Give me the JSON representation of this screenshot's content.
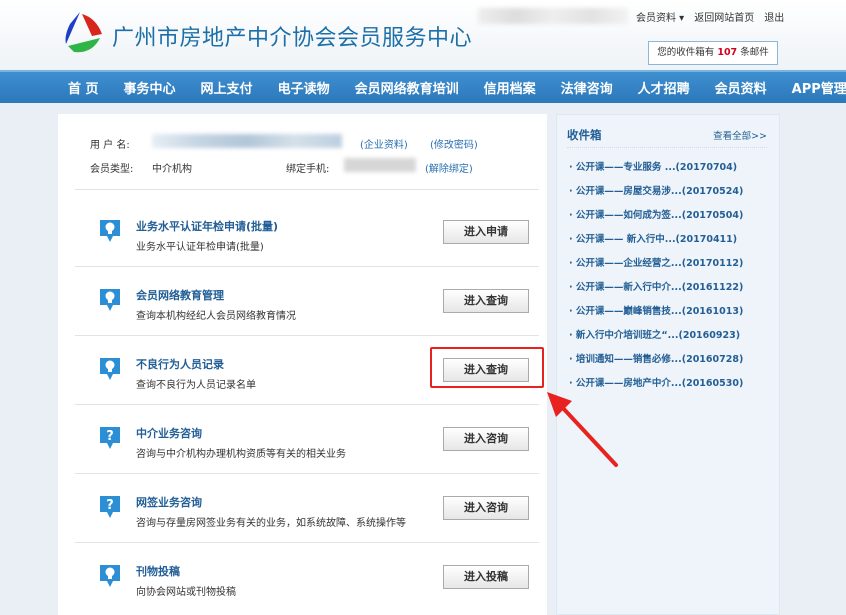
{
  "header": {
    "title": "广州市房地产中介协会会员服务中心",
    "links": [
      "会员资料 ▾",
      "返回网站首页",
      "退出"
    ],
    "mail_prefix": "您的收件箱有",
    "mail_count": "107",
    "mail_suffix": "条邮件"
  },
  "nav": [
    "首 页",
    "事务中心",
    "网上支付",
    "电子读物",
    "会员网络教育培训",
    "信用档案",
    "法律咨询",
    "人才招聘",
    "会员资料",
    "APP管理"
  ],
  "account": {
    "username_label": "用 户 名:",
    "company_link": "(企业资料)",
    "password_link": "(修改密码)",
    "type_label": "会员类型:",
    "type_value": "中介机构",
    "phone_label": "绑定手机:",
    "unbind_link": "(解除绑定)"
  },
  "services": [
    {
      "title": "业务水平认证年检申请(批量)",
      "desc": "业务水平认证年检申请(批量)",
      "button": "进入申请",
      "icon": "bulb"
    },
    {
      "title": "会员网络教育管理",
      "desc": "查询本机构经纪人会员网络教育情况",
      "button": "进入查询",
      "icon": "bulb"
    },
    {
      "title": "不良行为人员记录",
      "desc": "查询不良行为人员记录名单",
      "button": "进入查询",
      "icon": "bulb"
    },
    {
      "title": "中介业务咨询",
      "desc": "咨询与中介机构办理机构资质等有关的相关业务",
      "button": "进入咨询",
      "icon": "question"
    },
    {
      "title": "网签业务咨询",
      "desc": "咨询与存量房网签业务有关的业务，如系统故障、系统操作等",
      "button": "进入咨询",
      "icon": "question"
    },
    {
      "title": "刊物投稿",
      "desc": "向协会网站或刊物投稿",
      "button": "进入投稿",
      "icon": "bulb"
    }
  ],
  "inbox": {
    "title": "收件箱",
    "more": "查看全部>>",
    "items": [
      "· 公开课——专业服务 ...(20170704)",
      "· 公开课——房屋交易涉...(20170524)",
      "· 公开课——如何成为签...(20170504)",
      "· 公开课—— 新入行中...(20170411)",
      "· 公开课——企业经营之...(20170112)",
      "· 公开课——新入行中介...(20161122)",
      "· 公开课——巅峰销售技...(20161013)",
      "· 新入行中介培训班之“...(20160923)",
      "· 培训通知——销售必修...(20160728)",
      "· 公开课——房地产中介...(20160530)"
    ]
  },
  "colors": {
    "accent": "#2c78bb",
    "highlight": "#e8231f"
  }
}
